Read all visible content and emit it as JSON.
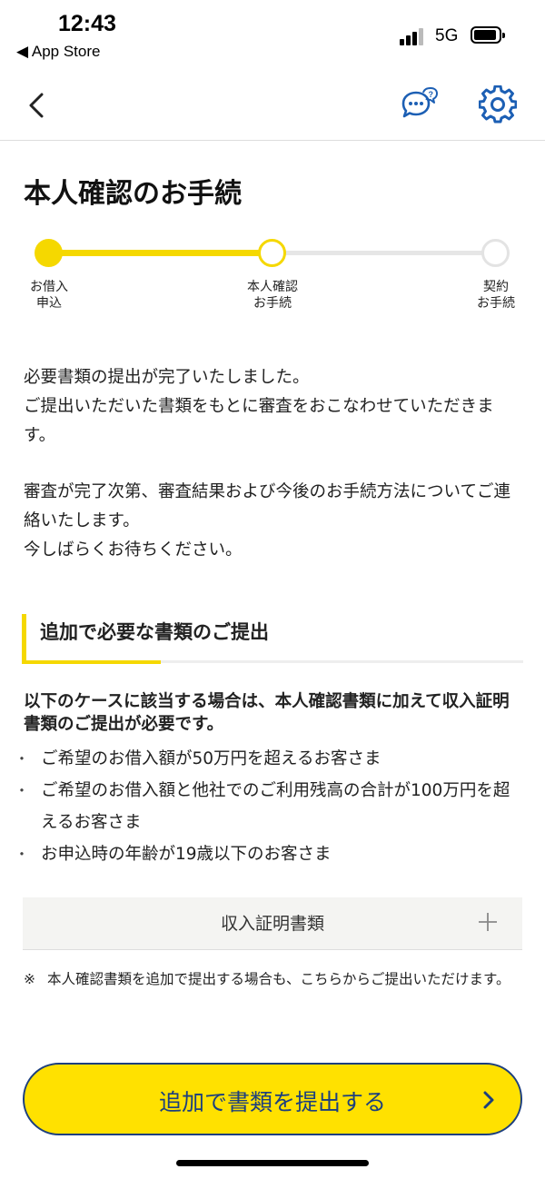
{
  "status_bar": {
    "time": "12:43",
    "back_app": "◀ App Store",
    "network": "5G"
  },
  "nav": {
    "back_icon": "chevron-left-icon",
    "chat_icon": "chat-help-icon",
    "settings_icon": "gear-icon",
    "accent_color": "#1c5fb4"
  },
  "page": {
    "title": "本人確認のお手続"
  },
  "progress": {
    "steps": [
      {
        "label": "お借入\n申込",
        "state": "done"
      },
      {
        "label": "本人確認\nお手続",
        "state": "current"
      },
      {
        "label": "契約\nお手続",
        "state": "upcoming"
      }
    ],
    "accent_color": "#f5d800"
  },
  "message": {
    "paragraph1": "必要書類の提出が完了いたしました。\nご提出いただいた書類をもとに審査をおこなわせていただきます。",
    "paragraph2": "審査が完了次第、審査結果および今後のお手続方法についてご連絡いたします。\n今しばらくお待ちください。"
  },
  "additional": {
    "title": "追加で必要な書類のご提出",
    "notice": "以下のケースに該当する場合は、本人確認書類に加えて収入証明書類のご提出が必要です。",
    "bullets": [
      "ご希望のお借入額が50万円を超えるお客さま",
      "ご希望のお借入額と他社でのご利用残高の合計が100万円を超えるお客さま",
      "お申込時の年齢が19歳以下のお客さま"
    ],
    "accordion_label": "収入証明書類",
    "note_mark": "※",
    "note_text": "本人確認書類を追加で提出する場合も、こちらからご提出いただけます。"
  },
  "submit": {
    "label": "追加で書類を提出する",
    "bg_color": "#ffe100",
    "text_color": "#1c3f7e"
  }
}
